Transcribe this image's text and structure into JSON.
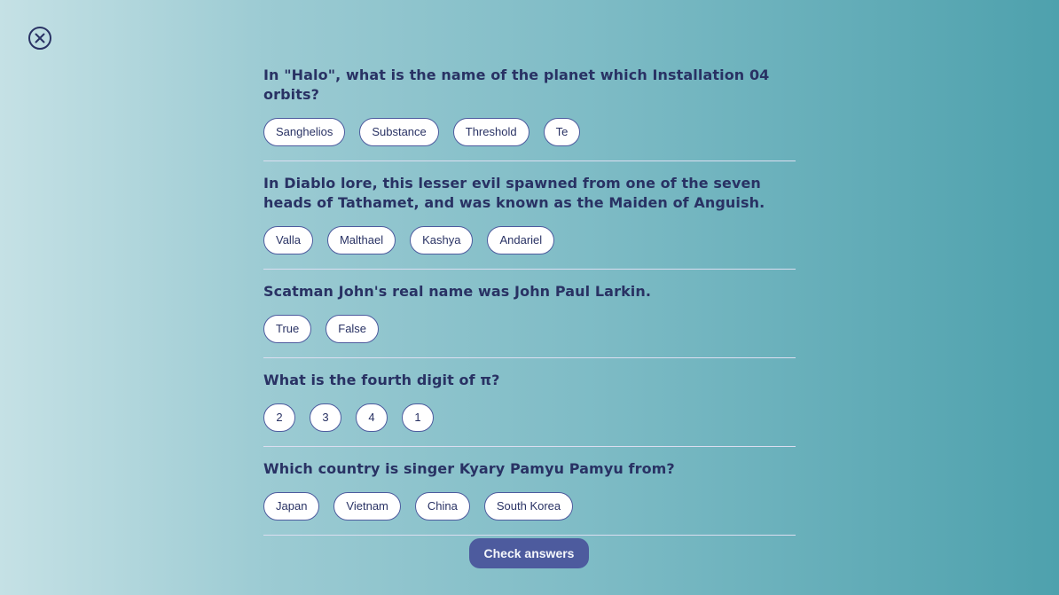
{
  "close": {
    "icon": "close-circle-icon"
  },
  "questions": [
    {
      "text": "In \"Halo\", what is the name of the planet which Installation 04 orbits?",
      "answers": [
        "Sanghelios",
        "Substance",
        "Threshold",
        "Te"
      ]
    },
    {
      "text": "In Diablo lore, this lesser evil spawned from one of the seven heads of Tathamet, and was known as the Maiden of Anguish.",
      "answers": [
        "Valla",
        "Malthael",
        "Kashya",
        "Andariel"
      ]
    },
    {
      "text": "Scatman John's real name was John Paul Larkin.",
      "answers": [
        "True",
        "False"
      ]
    },
    {
      "text": "What is the fourth digit of π?",
      "answers": [
        "2",
        "3",
        "4",
        "1"
      ]
    },
    {
      "text": "Which country is singer Kyary Pamyu Pamyu from?",
      "answers": [
        "Japan",
        "Vietnam",
        "China",
        "South Korea"
      ]
    }
  ],
  "check_button": {
    "label": "Check answers"
  },
  "colors": {
    "text": "#293264",
    "accent": "#4d5b9e",
    "divider": "#dbdef0",
    "answer_bg": "#ffffff"
  }
}
